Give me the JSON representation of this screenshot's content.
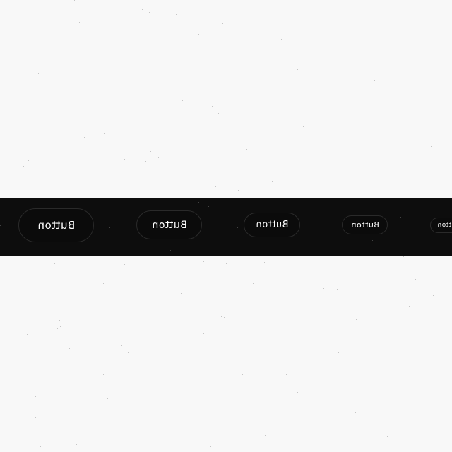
{
  "page": {
    "background_color": "#f8f8f8"
  },
  "band": {
    "background_color": "#0d0d0d"
  },
  "buttons": [
    {
      "label": "Button",
      "size": "xl"
    },
    {
      "label": "Button",
      "size": "lg"
    },
    {
      "label": "Button",
      "size": "md"
    },
    {
      "label": "Button",
      "size": "sm"
    },
    {
      "label": "Button",
      "size": "xs"
    }
  ],
  "colors": {
    "button_text": "#ffffff",
    "button_border": "#2a2a2a",
    "button_fill": "#0b0b0b"
  }
}
